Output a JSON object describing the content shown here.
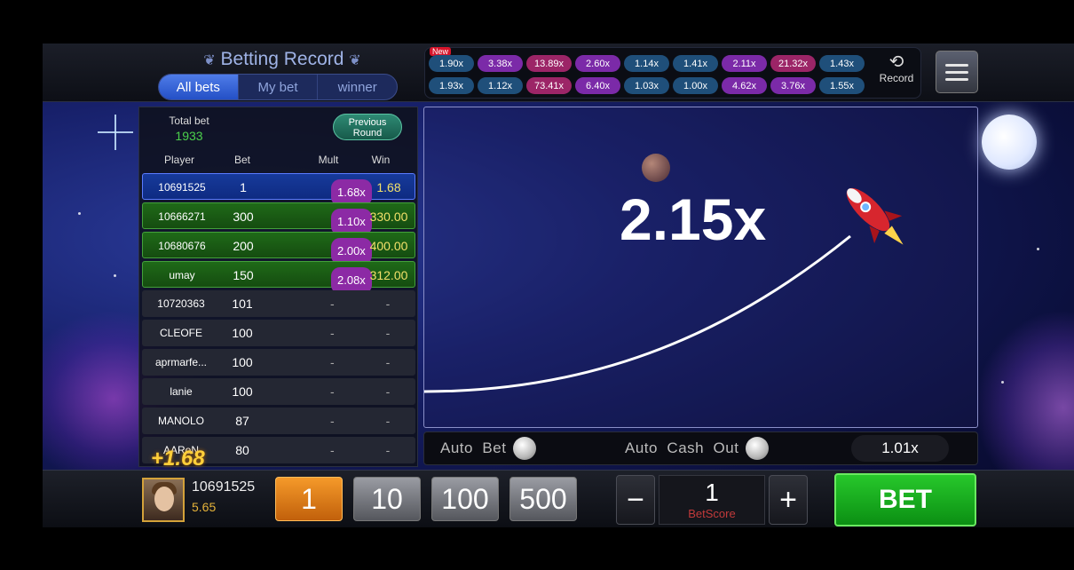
{
  "header": {
    "title": "Betting Record",
    "tabs": [
      {
        "label": "All bets"
      },
      {
        "label": "My bet"
      },
      {
        "label": "winner"
      }
    ],
    "history_new_badge": "New",
    "history_row1": [
      "1.90x",
      "3.38x",
      "13.89x",
      "2.60x",
      "1.14x",
      "1.41x",
      "2.11x",
      "21.32x",
      "1.43x"
    ],
    "history_row2": [
      "1.93x",
      "1.12x",
      "73.41x",
      "6.40x",
      "1.03x",
      "1.00x",
      "4.62x",
      "3.76x",
      "1.55x"
    ],
    "record_label": "Record"
  },
  "bets_panel": {
    "total_label": "Total bet",
    "total_value": "1933",
    "previous_round_label": "Previous Round",
    "columns": {
      "player": "Player",
      "bet": "Bet",
      "mult": "Mult",
      "win": "Win"
    },
    "rows": [
      {
        "player": "10691525",
        "bet": "1",
        "mult": "1.68x",
        "win": "1.68",
        "state": "mine"
      },
      {
        "player": "10666271",
        "bet": "300",
        "mult": "1.10x",
        "win": "330.00",
        "state": "won"
      },
      {
        "player": "10680676",
        "bet": "200",
        "mult": "2.00x",
        "win": "400.00",
        "state": "won"
      },
      {
        "player": "umay",
        "bet": "150",
        "mult": "2.08x",
        "win": "312.00",
        "state": "won"
      },
      {
        "player": "10720363",
        "bet": "101",
        "mult": "-",
        "win": "-",
        "state": "pending"
      },
      {
        "player": "CLEOFE",
        "bet": "100",
        "mult": "-",
        "win": "-",
        "state": "pending"
      },
      {
        "player": "aprmarfe...",
        "bet": "100",
        "mult": "-",
        "win": "-",
        "state": "pending"
      },
      {
        "player": "lanie",
        "bet": "100",
        "mult": "-",
        "win": "-",
        "state": "pending"
      },
      {
        "player": "MANOLO",
        "bet": "87",
        "mult": "-",
        "win": "-",
        "state": "pending"
      },
      {
        "player": "AARoN",
        "bet": "80",
        "mult": "-",
        "win": "-",
        "state": "pending"
      }
    ],
    "bonus_popup": "+1.68"
  },
  "game": {
    "multiplier": "2.15x",
    "auto_bet_label": "Auto  Bet",
    "auto_cashout_label": "Auto  Cash  Out",
    "auto_cashout_value": "1.01x"
  },
  "bottom": {
    "user_id": "10691525",
    "balance": "5.65",
    "chips": [
      "1",
      "10",
      "100",
      "500"
    ],
    "selected_chip": "1",
    "minus_symbol": "−",
    "plus_symbol": "+",
    "bet_score_value": "1",
    "bet_score_label": "BetScore",
    "bet_label": "BET"
  },
  "colors": {
    "accent_green": "#27c82b",
    "win_yellow": "#f2e16a",
    "mult_purple": "#8c2aa5",
    "chip_orange": "#f59a2a"
  }
}
